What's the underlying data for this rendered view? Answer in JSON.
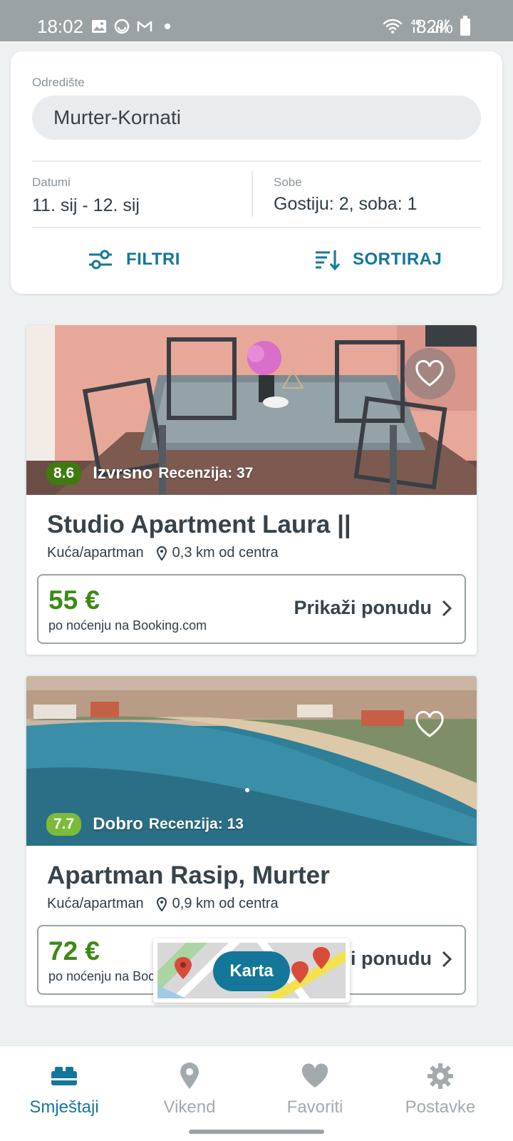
{
  "status_bar": {
    "time": "18:02",
    "battery": "82%",
    "network": "4G"
  },
  "search": {
    "destination_label": "Odredište",
    "destination_value": "Murter-Kornati",
    "dates_label": "Datumi",
    "dates_value": "11. sij - 12. sij",
    "rooms_label": "Sobe",
    "rooms_value": "Gostiju: 2, soba: 1",
    "filters_label": "FILTRI",
    "sort_label": "SORTIRAJ"
  },
  "listings": [
    {
      "score": "8.6",
      "rating_word": "Izvrsno",
      "reviews": "Recenzija: 37",
      "title": "Studio Apartment Laura ||",
      "type": "Kuća/apartman",
      "distance": "0,3 km od centra",
      "price": "55 €",
      "price_note": "po noćenju na Booking.com",
      "cta": "Prikaži ponudu"
    },
    {
      "score": "7.7",
      "rating_word": "Dobro",
      "reviews": "Recenzija: 13",
      "title": "Apartman Rasip, Murter",
      "type": "Kuća/apartman",
      "distance": "0,9 km od centra",
      "price": "72 €",
      "price_note": "po noćenju na Boc",
      "cta": "i ponudu"
    }
  ],
  "map_button": {
    "label": "Karta"
  },
  "bottom_nav": [
    {
      "label": "Smještaji",
      "icon": "bed-icon",
      "active": true
    },
    {
      "label": "Vikend",
      "icon": "location-pin-icon",
      "active": false
    },
    {
      "label": "Favoriti",
      "icon": "heart-icon",
      "active": false
    },
    {
      "label": "Postavke",
      "icon": "gear-icon",
      "active": false
    }
  ],
  "colors": {
    "accent": "#14779a",
    "price_green": "#3c8a15",
    "score_dark": "#3f7a10",
    "score_light": "#7cbb3a"
  }
}
